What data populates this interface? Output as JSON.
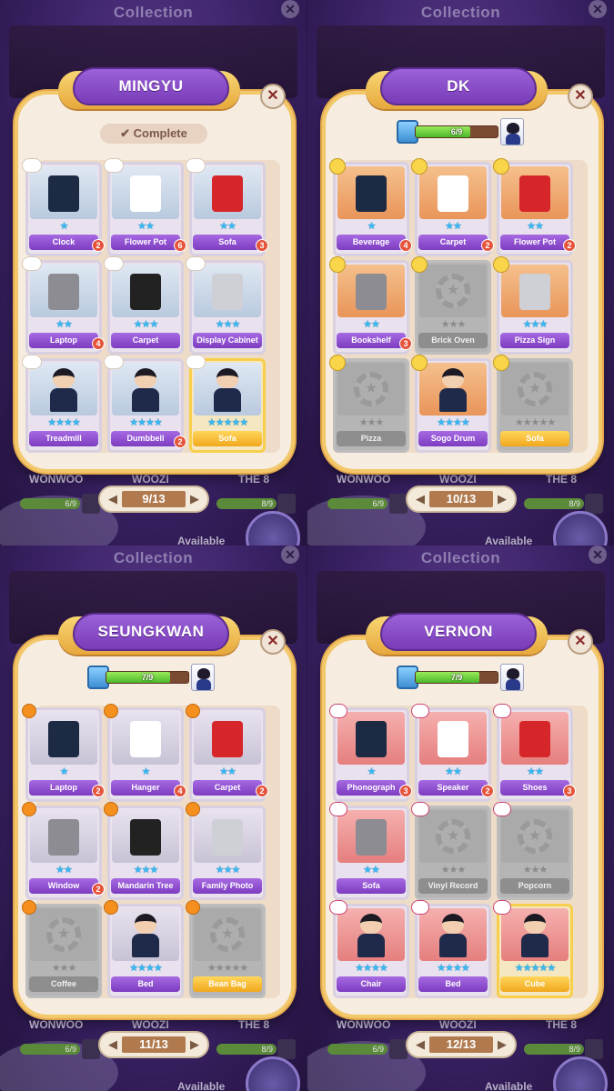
{
  "background": {
    "title": "Collection",
    "close_icon": "✕",
    "names": [
      "WONWOO",
      "WOOZI",
      "THE 8"
    ],
    "bar_values": [
      "6/9",
      "8/9"
    ],
    "available_label": "Available"
  },
  "panels": [
    {
      "member": "MINGYU",
      "status": "complete",
      "complete_label": "Complete",
      "page": "9/13",
      "theme": "theme-blue",
      "tag": "cloud",
      "items": [
        {
          "label": "Clock",
          "stars": 1,
          "badge": "2",
          "locked": false,
          "gold": false
        },
        {
          "label": "Flower Pot",
          "stars": 2,
          "badge": "6",
          "locked": false,
          "gold": false
        },
        {
          "label": "Sofa",
          "stars": 2,
          "badge": "3",
          "locked": false,
          "gold": false
        },
        {
          "label": "Laptop",
          "stars": 2,
          "badge": "4",
          "locked": false,
          "gold": false
        },
        {
          "label": "Carpet",
          "stars": 3,
          "badge": "",
          "locked": false,
          "gold": false
        },
        {
          "label": "Display Cabinet",
          "stars": 3,
          "badge": "",
          "locked": false,
          "gold": false
        },
        {
          "label": "Treadmill",
          "stars": 4,
          "badge": "",
          "locked": false,
          "gold": false
        },
        {
          "label": "Dumbbell",
          "stars": 4,
          "badge": "2",
          "locked": false,
          "gold": false
        },
        {
          "label": "Sofa",
          "stars": 5,
          "badge": "",
          "locked": false,
          "gold": true
        }
      ]
    },
    {
      "member": "DK",
      "status": "progress",
      "progress_text": "6/9",
      "progress_value": 0.67,
      "page": "10/13",
      "theme": "theme-orange",
      "tag": "key",
      "items": [
        {
          "label": "Beverage",
          "stars": 1,
          "badge": "4",
          "locked": false,
          "gold": false
        },
        {
          "label": "Carpet",
          "stars": 2,
          "badge": "2",
          "locked": false,
          "gold": false
        },
        {
          "label": "Flower Pot",
          "stars": 2,
          "badge": "2",
          "locked": false,
          "gold": false
        },
        {
          "label": "Bookshelf",
          "stars": 2,
          "badge": "3",
          "locked": false,
          "gold": false
        },
        {
          "label": "Brick Oven",
          "stars": 0,
          "badge": "",
          "locked": true,
          "gold": false
        },
        {
          "label": "Pizza Sign",
          "stars": 3,
          "badge": "",
          "locked": false,
          "gold": false
        },
        {
          "label": "Pizza",
          "stars": 0,
          "badge": "",
          "locked": true,
          "gold": false
        },
        {
          "label": "Sogo Drum",
          "stars": 4,
          "badge": "",
          "locked": false,
          "gold": false
        },
        {
          "label": "Sofa",
          "stars": 0,
          "badge": "",
          "locked": true,
          "gold": true
        }
      ]
    },
    {
      "member": "SEUNGKWAN",
      "status": "progress",
      "progress_text": "7/9",
      "progress_value": 0.78,
      "page": "11/13",
      "theme": "theme-orange-grey",
      "tag": "orange-fruit",
      "items": [
        {
          "label": "Laptop",
          "stars": 1,
          "badge": "2",
          "locked": false,
          "gold": false
        },
        {
          "label": "Hanger",
          "stars": 1,
          "badge": "4",
          "locked": false,
          "gold": false
        },
        {
          "label": "Carpet",
          "stars": 2,
          "badge": "2",
          "locked": false,
          "gold": false
        },
        {
          "label": "Window",
          "stars": 2,
          "badge": "2",
          "locked": false,
          "gold": false
        },
        {
          "label": "Mandarin Tree",
          "stars": 3,
          "badge": "",
          "locked": false,
          "gold": false
        },
        {
          "label": "Family Photo",
          "stars": 3,
          "badge": "",
          "locked": false,
          "gold": false
        },
        {
          "label": "Coffee",
          "stars": 0,
          "badge": "",
          "locked": true,
          "gold": false
        },
        {
          "label": "Bed",
          "stars": 4,
          "badge": "",
          "locked": false,
          "gold": false
        },
        {
          "label": "Bean Bag",
          "stars": 0,
          "badge": "",
          "locked": true,
          "gold": true
        }
      ]
    },
    {
      "member": "VERNON",
      "status": "progress",
      "progress_text": "7/9",
      "progress_value": 0.78,
      "page": "12/13",
      "theme": "theme-pink",
      "tag": "cards",
      "items": [
        {
          "label": "Phonograph",
          "stars": 1,
          "badge": "3",
          "locked": false,
          "gold": false
        },
        {
          "label": "Speaker",
          "stars": 2,
          "badge": "2",
          "locked": false,
          "gold": false
        },
        {
          "label": "Shoes",
          "stars": 2,
          "badge": "3",
          "locked": false,
          "gold": false
        },
        {
          "label": "Sofa",
          "stars": 2,
          "badge": "",
          "locked": false,
          "gold": false
        },
        {
          "label": "Vinyl Record",
          "stars": 0,
          "badge": "",
          "locked": true,
          "gold": false
        },
        {
          "label": "Popcorn",
          "stars": 0,
          "badge": "",
          "locked": true,
          "gold": false
        },
        {
          "label": "Chair",
          "stars": 4,
          "badge": "",
          "locked": false,
          "gold": false
        },
        {
          "label": "Bed",
          "stars": 4,
          "badge": "",
          "locked": false,
          "gold": false
        },
        {
          "label": "Cube",
          "stars": 5,
          "badge": "",
          "locked": false,
          "gold": true
        }
      ]
    }
  ]
}
